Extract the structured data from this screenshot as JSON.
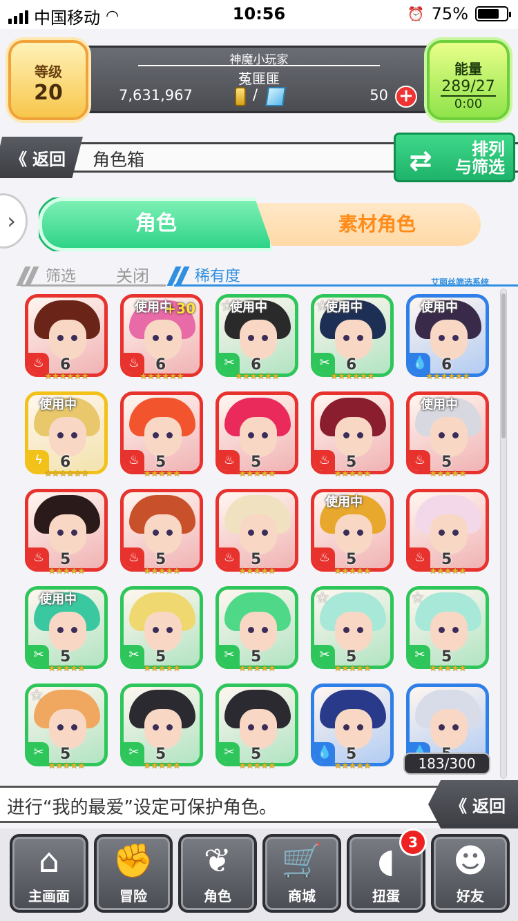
{
  "status_bar": {
    "carrier": "中国移动",
    "time": "10:56",
    "battery": "75%"
  },
  "header": {
    "level_label": "等级",
    "level": "20",
    "title": "神魔小玩家",
    "player_name": "菟匪匪",
    "gold": "7,631,967",
    "separator": "/",
    "gems": "50",
    "add": "+",
    "energy_label": "能量",
    "energy": "289/27",
    "energy_timer": "0:00"
  },
  "nav": {
    "back_label": "返回",
    "page_title": "角色箱",
    "sort_label_1": "排列",
    "sort_label_2": "与筛选"
  },
  "tabs": {
    "active": "角色",
    "inactive": "素材角色"
  },
  "filter": {
    "label": "筛选",
    "state": "关闭",
    "sort_by": "稀有度",
    "system": "艾丽丝筛选系统"
  },
  "colors": {
    "fire": "#e8322e",
    "wood": "#2ec65a",
    "water": "#2f7fe8",
    "light": "#f2c21a"
  },
  "cards": [
    {
      "element": "fire",
      "rarity": "6",
      "stars": "★★★★★★",
      "in_use": "",
      "fav": false,
      "plus": "",
      "hair": "#6a2418"
    },
    {
      "element": "fire",
      "rarity": "6",
      "stars": "★★★★★★",
      "in_use": "使用中",
      "fav": false,
      "plus": "+30",
      "hair": "#e86aa6"
    },
    {
      "element": "wood",
      "rarity": "6",
      "stars": "★★★★★★",
      "in_use": "使用中",
      "fav": true,
      "plus": "",
      "hair": "#2a2a2a"
    },
    {
      "element": "wood",
      "rarity": "6",
      "stars": "★★★★★★",
      "in_use": "使用中",
      "fav": true,
      "plus": "",
      "hair": "#1e2f55"
    },
    {
      "element": "water",
      "rarity": "6",
      "stars": "★★★★★★",
      "in_use": "使用中",
      "fav": false,
      "plus": "",
      "hair": "#3a2a4a"
    },
    {
      "element": "light",
      "rarity": "6",
      "stars": "★★★★★★",
      "in_use": "使用中",
      "fav": false,
      "plus": "",
      "hair": "#e8c86a"
    },
    {
      "element": "fire",
      "rarity": "5",
      "stars": "★★★★★",
      "in_use": "",
      "fav": false,
      "plus": "",
      "hair": "#f2552e"
    },
    {
      "element": "fire",
      "rarity": "5",
      "stars": "★★★★★",
      "in_use": "",
      "fav": false,
      "plus": "",
      "hair": "#ea2a5a"
    },
    {
      "element": "fire",
      "rarity": "5",
      "stars": "★★★★★",
      "in_use": "",
      "fav": false,
      "plus": "",
      "hair": "#8a1e2e"
    },
    {
      "element": "fire",
      "rarity": "5",
      "stars": "★★★★★",
      "in_use": "使用中",
      "fav": false,
      "plus": "",
      "hair": "#d8d8e0"
    },
    {
      "element": "fire",
      "rarity": "5",
      "stars": "★★★★★",
      "in_use": "",
      "fav": false,
      "plus": "",
      "hair": "#2a1a1a"
    },
    {
      "element": "fire",
      "rarity": "5",
      "stars": "★★★★★",
      "in_use": "",
      "fav": false,
      "plus": "",
      "hair": "#c8502a"
    },
    {
      "element": "fire",
      "rarity": "5",
      "stars": "★★★★★",
      "in_use": "",
      "fav": false,
      "plus": "",
      "hair": "#f0e2c0"
    },
    {
      "element": "fire",
      "rarity": "5",
      "stars": "★★★★★",
      "in_use": "使用中",
      "fav": false,
      "plus": "",
      "hair": "#e8a82e"
    },
    {
      "element": "fire",
      "rarity": "5",
      "stars": "★★★★★",
      "in_use": "",
      "fav": false,
      "plus": "",
      "hair": "#f2d8e8"
    },
    {
      "element": "wood",
      "rarity": "5",
      "stars": "★★★★★",
      "in_use": "使用中",
      "fav": false,
      "plus": "",
      "hair": "#3ac8a0"
    },
    {
      "element": "wood",
      "rarity": "5",
      "stars": "★★★★★",
      "in_use": "",
      "fav": false,
      "plus": "",
      "hair": "#f0d870"
    },
    {
      "element": "wood",
      "rarity": "5",
      "stars": "★★★★★",
      "in_use": "",
      "fav": false,
      "plus": "",
      "hair": "#4ed888"
    },
    {
      "element": "wood",
      "rarity": "5",
      "stars": "★★★★★",
      "in_use": "",
      "fav": true,
      "plus": "",
      "hair": "#a8e8d8"
    },
    {
      "element": "wood",
      "rarity": "5",
      "stars": "★★★★★",
      "in_use": "",
      "fav": true,
      "plus": "",
      "hair": "#a8e8d8"
    },
    {
      "element": "wood",
      "rarity": "5",
      "stars": "★★★★★",
      "in_use": "",
      "fav": true,
      "plus": "",
      "hair": "#f0a860"
    },
    {
      "element": "wood",
      "rarity": "5",
      "stars": "★★★★★",
      "in_use": "",
      "fav": false,
      "plus": "",
      "hair": "#2a2a30"
    },
    {
      "element": "wood",
      "rarity": "5",
      "stars": "★★★★★",
      "in_use": "",
      "fav": false,
      "plus": "",
      "hair": "#2a2a30"
    },
    {
      "element": "water",
      "rarity": "5",
      "stars": "★★★★★",
      "in_use": "",
      "fav": false,
      "plus": "",
      "hair": "#2a3a8a"
    },
    {
      "element": "water",
      "rarity": "5",
      "stars": "★★★★★",
      "in_use": "",
      "fav": false,
      "plus": "",
      "hair": "#d8dce8"
    }
  ],
  "count": "183/300",
  "tip": {
    "text": "进行“我的最爱”设定可保护角色。",
    "back_label": "返回"
  },
  "bottom_nav": [
    {
      "label": "主画面",
      "icon": "home-icon",
      "glyph": "⌂"
    },
    {
      "label": "冒险",
      "icon": "handshake-icon",
      "glyph": "✊"
    },
    {
      "label": "角色",
      "icon": "rabbit-icon",
      "glyph": "❦"
    },
    {
      "label": "商城",
      "icon": "cart-icon",
      "glyph": "🛒"
    },
    {
      "label": "扭蛋",
      "icon": "egg-icon",
      "glyph": "◖",
      "badge": "3"
    },
    {
      "label": "好友",
      "icon": "friends-icon",
      "glyph": "☻"
    }
  ]
}
